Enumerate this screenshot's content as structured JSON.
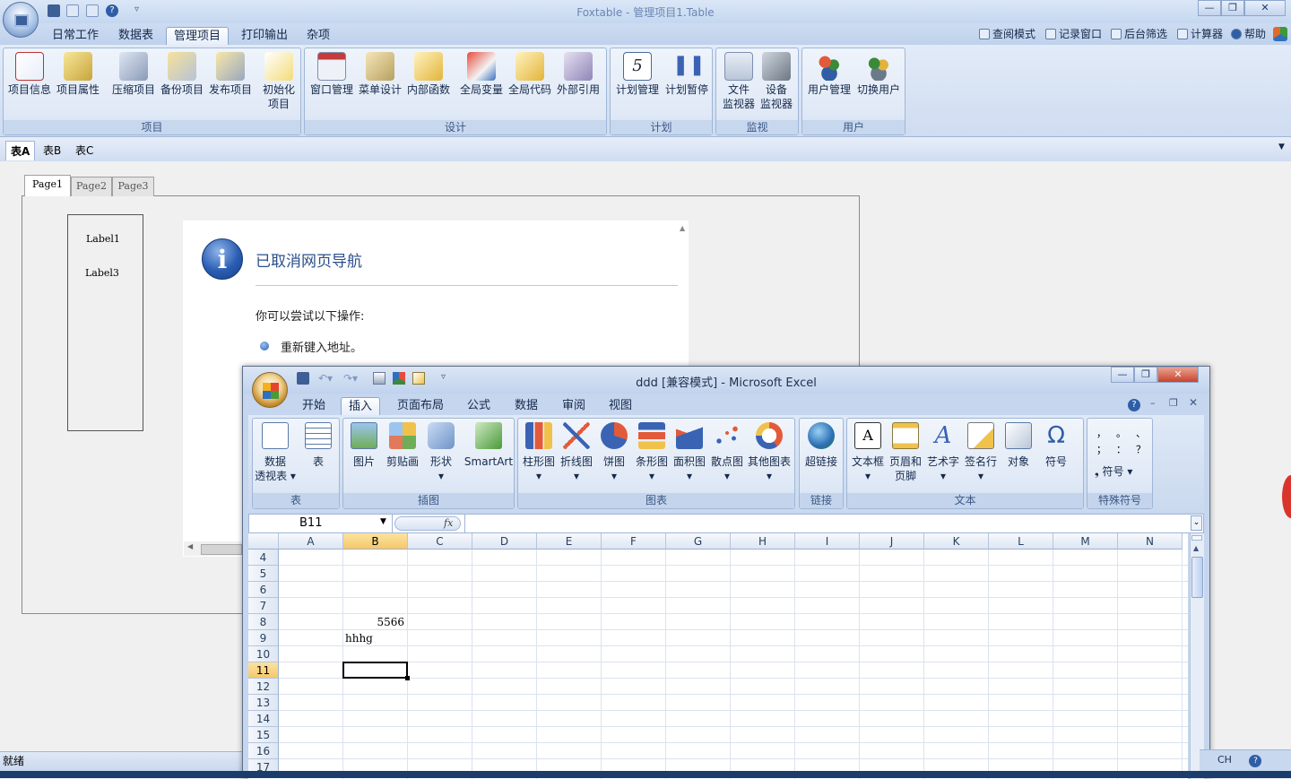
{
  "foxtable": {
    "title": "Foxtable - 管理项目1.Table",
    "window_buttons": [
      "—",
      "❐",
      "✕"
    ],
    "menu_tabs": [
      "日常工作",
      "数据表",
      "管理项目",
      "打印输出",
      "杂项"
    ],
    "active_menu_tab": "管理项目",
    "right_links": [
      "查阅模式",
      "记录窗口",
      "后台筛选",
      "计算器",
      "帮助"
    ],
    "ribbon_groups": [
      {
        "label": "项目",
        "buttons": [
          "项目信息",
          "项目属性",
          "压缩项目",
          "备份项目",
          "发布项目",
          "初始化\n项目"
        ]
      },
      {
        "label": "设计",
        "buttons": [
          "窗口管理",
          "菜单设计",
          "内部函数",
          "全局变量",
          "全局代码",
          "外部引用"
        ]
      },
      {
        "label": "计划",
        "buttons": [
          "计划管理",
          "计划暂停"
        ]
      },
      {
        "label": "监视",
        "buttons": [
          "文件\n监视器",
          "设备\n监视器"
        ]
      },
      {
        "label": "用户",
        "buttons": [
          "用户管理",
          "切换用户"
        ]
      }
    ],
    "table_tabs": [
      "表A",
      "表B",
      "表C"
    ],
    "active_table_tab": "表A",
    "status_text": "就绪"
  },
  "form": {
    "page_tabs": [
      "Page1",
      "Page2",
      "Page3"
    ],
    "labels": [
      "Label1",
      "Label3"
    ]
  },
  "browser": {
    "heading": "已取消网页导航",
    "subheading": "你可以尝试以下操作:",
    "bullet": "重新键入地址。",
    "info_glyph": "i"
  },
  "excel": {
    "title": "ddd  [兼容模式] - Microsoft Excel",
    "tabs": [
      "开始",
      "插入",
      "页面布局",
      "公式",
      "数据",
      "审阅",
      "视图"
    ],
    "active_tab": "插入",
    "ribbon_groups": [
      {
        "label": "表",
        "buttons": [
          "数据\n透视表 ▾",
          "表"
        ]
      },
      {
        "label": "插图",
        "buttons": [
          "图片",
          "剪贴画",
          "形状\n▾",
          "SmartArt"
        ]
      },
      {
        "label": "图表",
        "buttons": [
          "柱形图\n▾",
          "折线图\n▾",
          "饼图\n▾",
          "条形图\n▾",
          "面积图\n▾",
          "散点图\n▾",
          "其他图表\n▾"
        ]
      },
      {
        "label": "链接",
        "buttons": [
          "超链接"
        ]
      },
      {
        "label": "文本",
        "buttons": [
          "文本框\n▾",
          "页眉和\n页脚",
          "艺术字\n▾",
          "签名行\n▾",
          "对象",
          "符号"
        ]
      },
      {
        "label": "特殊符号",
        "buttons": [
          "符号 ▾"
        ]
      }
    ],
    "special_symbols": [
      "，",
      "。",
      "、",
      "；",
      "：",
      "？"
    ],
    "name_box": "B11",
    "fx_label": "fx",
    "columns": [
      "A",
      "B",
      "C",
      "D",
      "E",
      "F",
      "G",
      "H",
      "I",
      "J",
      "K",
      "L",
      "M",
      "N"
    ],
    "rows": [
      "4",
      "5",
      "6",
      "7",
      "8",
      "9",
      "10",
      "11",
      "12",
      "13",
      "14",
      "15",
      "16",
      "17"
    ],
    "selected_cell": "B11",
    "cells": [
      {
        "ref": "B8",
        "value": "5566",
        "align": "right"
      },
      {
        "ref": "A9",
        "value": "hhhg",
        "align": "left"
      }
    ],
    "status_right": "CH"
  },
  "colors": {
    "ribbon_blue": "#cfdcf0",
    "accent": "#15294b",
    "selected_header": "#f5c86a"
  }
}
